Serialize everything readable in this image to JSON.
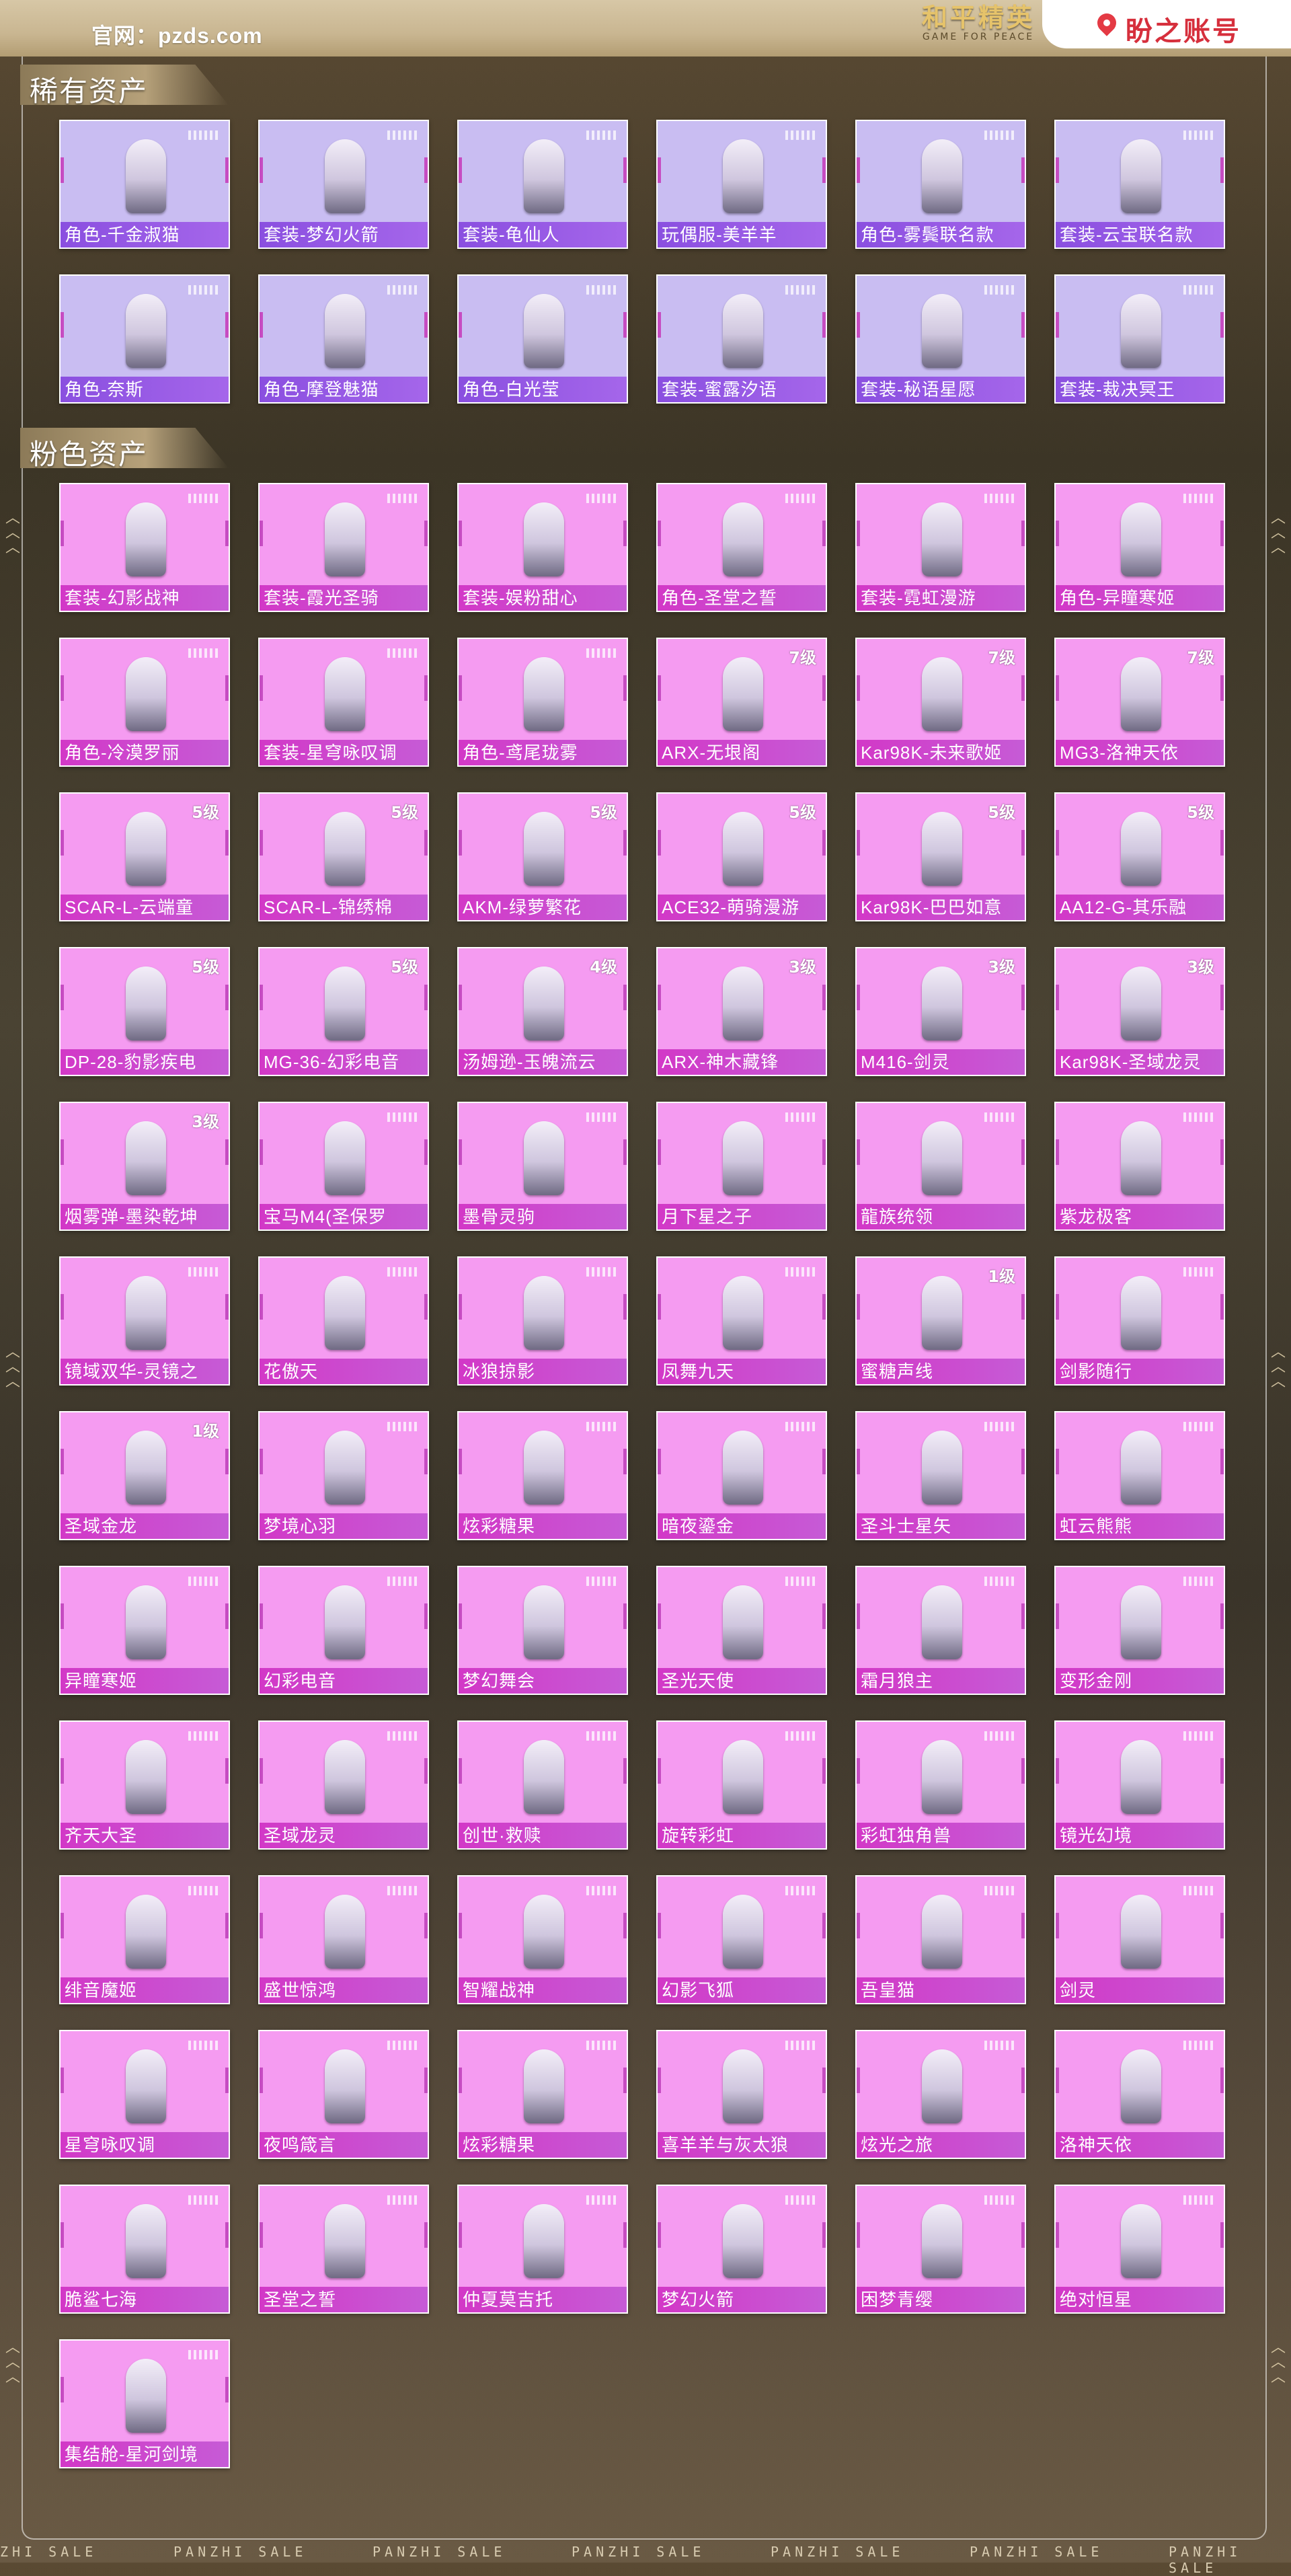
{
  "header": {
    "site_label": "官网：pzds.com",
    "game_title_cn": "和平精英",
    "game_title_en": "GAME FOR PEACE",
    "brand_name": "盼之账号",
    "brand_color": "#d62f3c"
  },
  "sections": {
    "rare": {
      "title": "稀有资产",
      "items": [
        {
          "name": "角色-千金淑猫"
        },
        {
          "name": "套装-梦幻火箭"
        },
        {
          "name": "套装-龟仙人"
        },
        {
          "name": "玩偶服-美羊羊"
        },
        {
          "name": "角色-雾鬓联名款"
        },
        {
          "name": "套装-云宝联名款"
        },
        {
          "name": "角色-奈斯"
        },
        {
          "name": "角色-摩登魅猫"
        },
        {
          "name": "角色-白光莹"
        },
        {
          "name": "套装-蜜露汐语"
        },
        {
          "name": "套装-秘语星愿"
        },
        {
          "name": "套装-裁决冥王"
        }
      ]
    },
    "pink": {
      "title": "粉色资产",
      "items": [
        {
          "name": "套装-幻影战神"
        },
        {
          "name": "套装-霞光圣骑"
        },
        {
          "name": "套装-娱粉甜心"
        },
        {
          "name": "角色-圣堂之誓"
        },
        {
          "name": "套装-霓虹漫游"
        },
        {
          "name": "角色-异瞳寒姬"
        },
        {
          "name": "角色-冷漠罗丽"
        },
        {
          "name": "套装-星穹咏叹调"
        },
        {
          "name": "角色-鸢尾珑雾"
        },
        {
          "name": "ARX-无垠阁",
          "level": "7级"
        },
        {
          "name": "Kar98K-未来歌姬",
          "level": "7级"
        },
        {
          "name": "MG3-洛神天依",
          "level": "7级"
        },
        {
          "name": "SCAR-L-云端童",
          "level": "5级"
        },
        {
          "name": "SCAR-L-锦绣棉",
          "level": "5级"
        },
        {
          "name": "AKM-绿萝繁花",
          "level": "5级"
        },
        {
          "name": "ACE32-萌骑漫游",
          "level": "5级"
        },
        {
          "name": "Kar98K-巴巴如意",
          "level": "5级"
        },
        {
          "name": "AA12-G-其乐融",
          "level": "5级"
        },
        {
          "name": "DP-28-豹影疾电",
          "level": "5级"
        },
        {
          "name": "MG-36-幻彩电音",
          "level": "5级"
        },
        {
          "name": "汤姆逊-玉魄流云",
          "level": "4级"
        },
        {
          "name": "ARX-神木藏锋",
          "level": "3级"
        },
        {
          "name": "M416-剑灵",
          "level": "3级"
        },
        {
          "name": "Kar98K-圣域龙灵",
          "level": "3级"
        },
        {
          "name": "烟雾弹-墨染乾坤",
          "level": "3级"
        },
        {
          "name": "宝马M4(圣保罗"
        },
        {
          "name": "墨骨灵驹"
        },
        {
          "name": "月下星之子"
        },
        {
          "name": "龍族统领"
        },
        {
          "name": "紫龙极客"
        },
        {
          "name": "镜域双华-灵镜之"
        },
        {
          "name": "花傲天"
        },
        {
          "name": "冰狼掠影"
        },
        {
          "name": "凤舞九天"
        },
        {
          "name": "蜜糖声线",
          "level": "1级"
        },
        {
          "name": "剑影随行"
        },
        {
          "name": "圣域金龙",
          "level": "1级"
        },
        {
          "name": "梦境心羽"
        },
        {
          "name": "炫彩糖果"
        },
        {
          "name": "暗夜鎏金"
        },
        {
          "name": "圣斗士星矢"
        },
        {
          "name": "虹云熊熊"
        },
        {
          "name": "异瞳寒姬"
        },
        {
          "name": "幻彩电音"
        },
        {
          "name": "梦幻舞会"
        },
        {
          "name": "圣光天使"
        },
        {
          "name": "霜月狼主"
        },
        {
          "name": "变形金刚"
        },
        {
          "name": "齐天大圣"
        },
        {
          "name": "圣域龙灵"
        },
        {
          "name": "创世·救赎"
        },
        {
          "name": "旋转彩虹"
        },
        {
          "name": "彩虹独角兽"
        },
        {
          "name": "镜光幻境"
        },
        {
          "name": "绯音魔姬"
        },
        {
          "name": "盛世惊鸿"
        },
        {
          "name": "智耀战神"
        },
        {
          "name": "幻影飞狐"
        },
        {
          "name": "吾皇猫"
        },
        {
          "name": "剑灵"
        },
        {
          "name": "星穹咏叹调"
        },
        {
          "name": "夜鸣箴言"
        },
        {
          "name": "炫彩糖果"
        },
        {
          "name": "喜羊羊与灰太狼"
        },
        {
          "name": "炫光之旅"
        },
        {
          "name": "洛神天依"
        },
        {
          "name": "脆鲨七海"
        },
        {
          "name": "圣堂之誓"
        },
        {
          "name": "仲夏莫吉托"
        },
        {
          "name": "梦幻火箭"
        },
        {
          "name": "困梦青缨"
        },
        {
          "name": "绝对恒星"
        },
        {
          "name": "集结舱-星河剑境"
        }
      ]
    }
  },
  "footer": {
    "watermark": "PANZHI SALE",
    "left_fragment": "ZHI SALE"
  },
  "colors": {
    "pink_card": "#f59bf1",
    "pink_label": "#d238c7",
    "rare_card": "#c9bdf2",
    "rare_label": "#8a4fe0"
  }
}
